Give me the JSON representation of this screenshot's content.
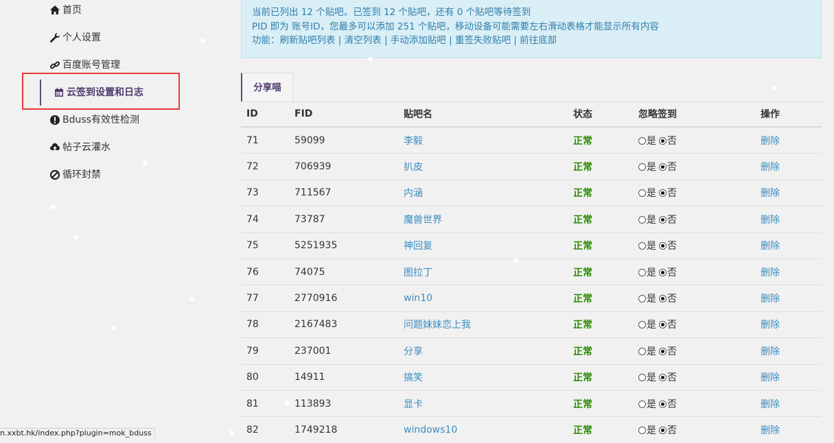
{
  "sidebar": {
    "items": [
      {
        "label": "首页",
        "icon": "home-icon"
      },
      {
        "label": "个人设置",
        "icon": "wrench-icon"
      },
      {
        "label": "百度账号管理",
        "icon": "link-icon"
      },
      {
        "label": "云签到设置和日志",
        "icon": "calendar-icon",
        "active": true
      },
      {
        "label": "Bduss有效性检测",
        "icon": "exclamation-circle-icon"
      },
      {
        "label": "帖子云灌水",
        "icon": "cloud-upload-icon"
      },
      {
        "label": "循环封禁",
        "icon": "ban-icon"
      }
    ]
  },
  "alert": {
    "line1": "当前已列出 12 个贴吧。已签到 12 个贴吧，还有 0 个贴吧等待签到",
    "line2": "PID 即为 账号ID，您最多可以添加 251 个贴吧，移动设备可能需要左右滑动表格才能显示所有内容",
    "functions_label": "功能：",
    "links": [
      "刷新贴吧列表",
      "清空列表",
      "手动添加贴吧",
      "重签失败贴吧",
      "前往底部"
    ],
    "separator": "|"
  },
  "tab": {
    "label": "分享喵"
  },
  "table": {
    "headers": [
      "ID",
      "FID",
      "贴吧名",
      "状态",
      "忽略签到",
      "操作"
    ],
    "yes_label": "是",
    "no_label": "否",
    "delete_label": "删除",
    "rows": [
      {
        "id": "71",
        "fid": "59099",
        "name": "李毅",
        "status": "正常"
      },
      {
        "id": "72",
        "fid": "706939",
        "name": "扒皮",
        "status": "正常"
      },
      {
        "id": "73",
        "fid": "711567",
        "name": "内涵",
        "status": "正常"
      },
      {
        "id": "74",
        "fid": "73787",
        "name": "魔兽世界",
        "status": "正常"
      },
      {
        "id": "75",
        "fid": "5251935",
        "name": "神回复",
        "status": "正常"
      },
      {
        "id": "76",
        "fid": "74075",
        "name": "图拉丁",
        "status": "正常"
      },
      {
        "id": "77",
        "fid": "2770916",
        "name": "win10",
        "status": "正常"
      },
      {
        "id": "78",
        "fid": "2167483",
        "name": "问题妹妹恋上我",
        "status": "正常"
      },
      {
        "id": "79",
        "fid": "237001",
        "name": "分享",
        "status": "正常"
      },
      {
        "id": "80",
        "fid": "14911",
        "name": "搞笑",
        "status": "正常"
      },
      {
        "id": "81",
        "fid": "113893",
        "name": "显卡",
        "status": "正常"
      },
      {
        "id": "82",
        "fid": "1749218",
        "name": "windows10",
        "status": "正常"
      }
    ]
  },
  "statusbar": {
    "url": "n.xxbt.hk/index.php?plugin=mok_bduss"
  },
  "colors": {
    "accent": "#5b4a80",
    "link": "#3a8dc1",
    "status_ok": "#2a8a00",
    "alert_bg": "#daeef6",
    "highlight": "#e53935"
  }
}
